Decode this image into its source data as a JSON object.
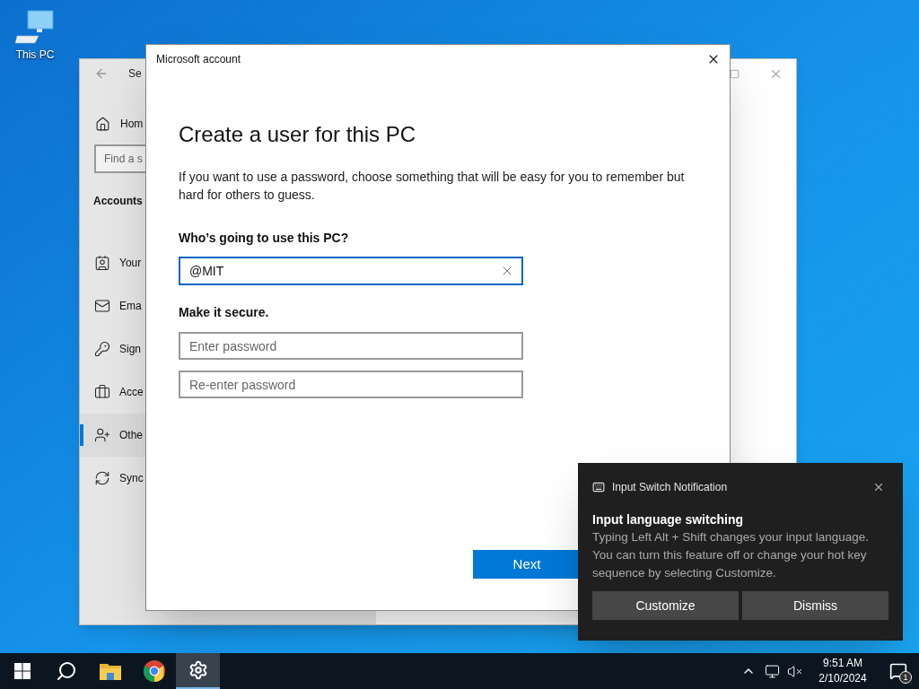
{
  "desktop_icons": [
    {
      "label": "This PC"
    }
  ],
  "settings_window": {
    "title": "Se",
    "home": "Hom",
    "search": {
      "placeholder": "Find a s"
    },
    "section": "Accounts",
    "items": [
      {
        "kind": "info",
        "label": "Your",
        "selected": false
      },
      {
        "kind": "mail",
        "label": "Ema",
        "selected": false
      },
      {
        "kind": "key",
        "label": "Sign",
        "selected": false
      },
      {
        "kind": "work",
        "label": "Acce",
        "selected": false
      },
      {
        "kind": "family",
        "label": "Othe",
        "selected": true
      },
      {
        "kind": "sync",
        "label": "Sync",
        "selected": false
      }
    ]
  },
  "dialog": {
    "title": "Microsoft account",
    "heading": "Create a user for this PC",
    "description": "If you want to use a password, choose something that will be easy for you to remember but hard for others to guess.",
    "name_label": "Who’s going to use this PC?",
    "name_field": {
      "value": "@MIT"
    },
    "secure_label": "Make it secure.",
    "password_fields": [
      {
        "placeholder": "Enter password"
      },
      {
        "placeholder": "Re-enter password"
      }
    ],
    "next_button": "Next"
  },
  "toast": {
    "app": "Input Switch Notification",
    "title": "Input language switching",
    "body": "Typing Left Alt + Shift changes your input language. You can turn this feature off or change your hot key sequence by selecting Customize.",
    "buttons": [
      "Customize",
      "Dismiss"
    ]
  },
  "taskbar": {
    "apps": [
      {
        "kind": "start",
        "selected": false
      },
      {
        "kind": "search",
        "selected": false
      },
      {
        "kind": "explorer",
        "selected": false
      },
      {
        "kind": "chrome",
        "selected": false
      },
      {
        "kind": "settings",
        "selected": true
      }
    ],
    "clock": {
      "time": "9:51 AM",
      "date": "2/10/2024"
    },
    "notification_count": "1"
  }
}
